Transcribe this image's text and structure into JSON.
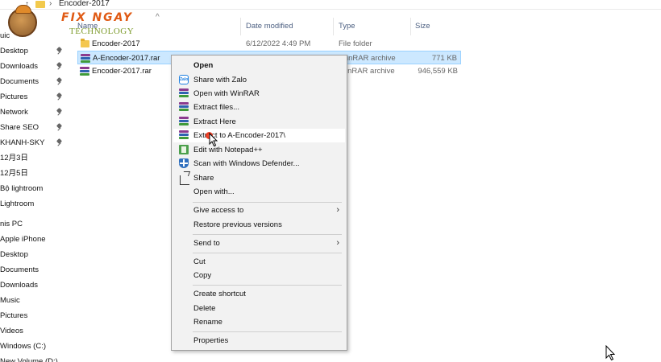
{
  "breadcrumb": {
    "current": "Encoder-2017"
  },
  "logo": {
    "title": "FIX NGAY",
    "subtitle": "TECHNOLOGY"
  },
  "nav": {
    "items": [
      {
        "label": "uic",
        "pinned": false
      },
      {
        "label": "Desktop",
        "pinned": true
      },
      {
        "label": "Downloads",
        "pinned": true
      },
      {
        "label": "Documents",
        "pinned": true
      },
      {
        "label": "Pictures",
        "pinned": true
      },
      {
        "label": "Network",
        "pinned": true
      },
      {
        "label": "Share SEO",
        "pinned": true
      },
      {
        "label": "KHANH-SKY",
        "pinned": true
      },
      {
        "label": "12月3日",
        "pinned": false
      },
      {
        "label": "12月5日",
        "pinned": false
      },
      {
        "label": "Bộ lightroom",
        "pinned": false
      },
      {
        "label": "Lightroom",
        "pinned": false
      },
      {
        "label": "nis PC",
        "pinned": false
      },
      {
        "label": "Apple iPhone",
        "pinned": false
      },
      {
        "label": "Desktop",
        "pinned": false
      },
      {
        "label": "Documents",
        "pinned": false
      },
      {
        "label": "Downloads",
        "pinned": false
      },
      {
        "label": "Music",
        "pinned": false
      },
      {
        "label": "Pictures",
        "pinned": false
      },
      {
        "label": "Videos",
        "pinned": false
      },
      {
        "label": "Windows (C:)",
        "pinned": false
      },
      {
        "label": "New Volume (D:)",
        "pinned": false
      }
    ]
  },
  "columns": {
    "name": "Name",
    "date": "Date modified",
    "type": "Type",
    "size": "Size"
  },
  "files": [
    {
      "name": "Encoder-2017",
      "date": "6/12/2022 4:49 PM",
      "type": "File folder",
      "size": "",
      "icon": "folder-icon"
    },
    {
      "name": "A-Encoder-2017.rar",
      "date": "",
      "type": "WinRAR archive",
      "size": "771 KB",
      "icon": "winrar-icon"
    },
    {
      "name": "Encoder-2017.rar",
      "date": "",
      "type": "WinRAR archive",
      "size": "946,559 KB",
      "icon": "winrar-icon"
    }
  ],
  "context_menu": {
    "open": "Open",
    "share_zalo": "Share with Zalo",
    "open_winrar": "Open with WinRAR",
    "extract_files": "Extract files...",
    "extract_here": "Extract Here",
    "extract_to": "Extract to A-Encoder-2017\\",
    "edit_notepad": "Edit with Notepad++",
    "scan_defender": "Scan with Windows Defender...",
    "share": "Share",
    "open_with": "Open with...",
    "give_access": "Give access to",
    "restore_versions": "Restore previous versions",
    "send_to": "Send to",
    "cut": "Cut",
    "copy": "Copy",
    "create_shortcut": "Create shortcut",
    "delete": "Delete",
    "rename": "Rename",
    "properties": "Properties",
    "zalo_icon_text": "Zalo"
  },
  "colors": {
    "selection": "#cce8ff",
    "menu_bg": "#f2f2f2",
    "header_text": "#4d6082",
    "folder": "#f4c74f"
  }
}
